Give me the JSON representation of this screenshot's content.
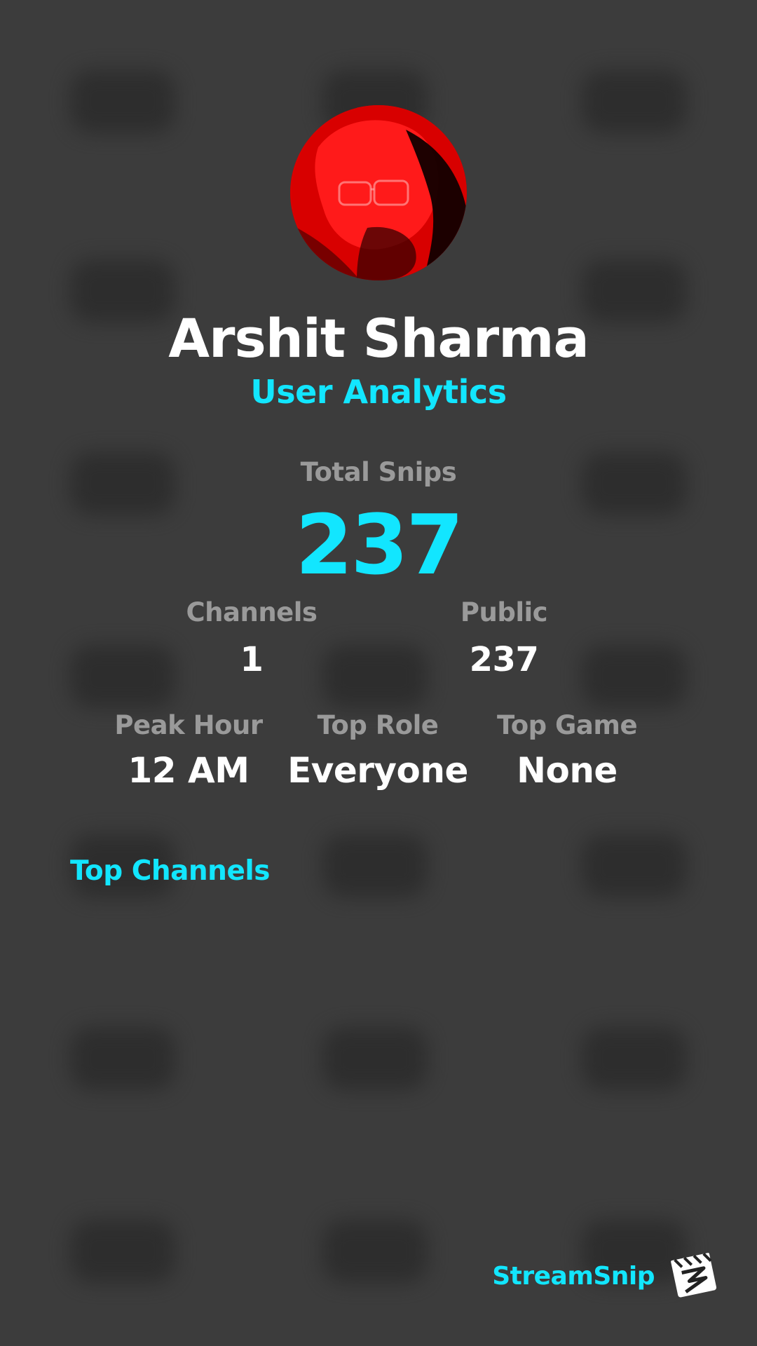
{
  "profile": {
    "name": "Arshit Sharma",
    "subtitle": "User Analytics"
  },
  "stats": {
    "total_snips": {
      "label": "Total Snips",
      "value": "237"
    },
    "channels": {
      "label": "Channels",
      "value": "1"
    },
    "public": {
      "label": "Public",
      "value": "237"
    },
    "peak_hour": {
      "label": "Peak Hour",
      "value": "12 AM"
    },
    "top_role": {
      "label": "Top Role",
      "value": "Everyone"
    },
    "top_game": {
      "label": "Top Game",
      "value": "None"
    }
  },
  "sections": {
    "top_channels_title": "Top Channels"
  },
  "branding": {
    "name": "StreamSnip",
    "logo_icon": "clapperboard-icon"
  },
  "colors": {
    "accent": "#12e6ff",
    "background": "#3c3c3c",
    "label": "#9a9a9a",
    "value": "#ffffff"
  }
}
